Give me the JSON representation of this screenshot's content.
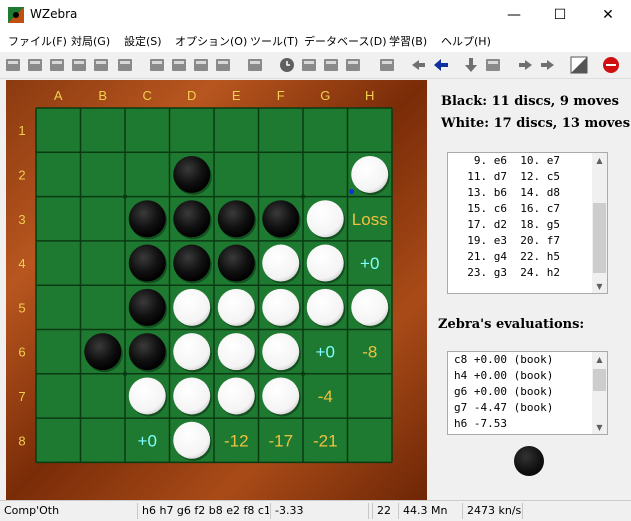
{
  "window": {
    "title": "WZebra"
  },
  "menu": [
    "ファイル(F)",
    "対局(G)",
    "設定(S)",
    "オプション(O)",
    "ツール(T)",
    "データベース(D)",
    "学習(B)",
    "ヘルプ(H)"
  ],
  "toolbar": {
    "icons": [
      "new-game-icon",
      "new-board-icon",
      "open-icon",
      "save-icon",
      "save-as-icon",
      "folder-icon",
      "swap-icon",
      "print-icon",
      "print-preview-icon",
      "zebra-z-icon",
      "wand-icon",
      "clock-icon",
      "stop-icon",
      "pause-icon",
      "step-icon",
      "book-icon",
      "undo-all-icon",
      "back-icon",
      "down-icon",
      "hint-icon",
      "forward-icon",
      "redo-all-icon",
      "flip-board-icon",
      "stop-search-icon"
    ]
  },
  "board": {
    "columns": [
      "A",
      "B",
      "C",
      "D",
      "E",
      "F",
      "G",
      "H"
    ],
    "rows": [
      "1",
      "2",
      "3",
      "4",
      "5",
      "6",
      "7",
      "8"
    ],
    "discs": [
      {
        "sq": "D2",
        "color": "black"
      },
      {
        "sq": "H2",
        "color": "white"
      },
      {
        "sq": "C3",
        "color": "black"
      },
      {
        "sq": "D3",
        "color": "black"
      },
      {
        "sq": "E3",
        "color": "black"
      },
      {
        "sq": "F3",
        "color": "black"
      },
      {
        "sq": "G3",
        "color": "white"
      },
      {
        "sq": "C4",
        "color": "black"
      },
      {
        "sq": "D4",
        "color": "black"
      },
      {
        "sq": "E4",
        "color": "black"
      },
      {
        "sq": "F4",
        "color": "white"
      },
      {
        "sq": "G4",
        "color": "white"
      },
      {
        "sq": "C5",
        "color": "black"
      },
      {
        "sq": "D5",
        "color": "white"
      },
      {
        "sq": "E5",
        "color": "white"
      },
      {
        "sq": "F5",
        "color": "white"
      },
      {
        "sq": "G5",
        "color": "white"
      },
      {
        "sq": "H5",
        "color": "white"
      },
      {
        "sq": "B6",
        "color": "black"
      },
      {
        "sq": "C6",
        "color": "black"
      },
      {
        "sq": "D6",
        "color": "white"
      },
      {
        "sq": "E6",
        "color": "white"
      },
      {
        "sq": "F6",
        "color": "white"
      },
      {
        "sq": "C7",
        "color": "white"
      },
      {
        "sq": "D7",
        "color": "white"
      },
      {
        "sq": "E7",
        "color": "white"
      },
      {
        "sq": "F7",
        "color": "white"
      },
      {
        "sq": "D8",
        "color": "white"
      }
    ],
    "evals": [
      {
        "sq": "H3",
        "text": "Loss",
        "color": "#f0c040"
      },
      {
        "sq": "H4",
        "text": "+0",
        "color": "#80ffff"
      },
      {
        "sq": "G6",
        "text": "+0",
        "color": "#80ffff"
      },
      {
        "sq": "H6",
        "text": "-8",
        "color": "#f0c040"
      },
      {
        "sq": "G7",
        "text": "-4",
        "color": "#f0c040"
      },
      {
        "sq": "C8",
        "text": "+0",
        "color": "#80ffff"
      },
      {
        "sq": "E8",
        "text": "-12",
        "color": "#f0c040"
      },
      {
        "sq": "F8",
        "text": "-17",
        "color": "#f0c040"
      },
      {
        "sq": "G8",
        "text": "-21",
        "color": "#f0c040"
      }
    ],
    "last_move_marker": "H2",
    "colors": {
      "felt": "#1e7a30",
      "line": "#0a3a12",
      "label": "#f0d050"
    }
  },
  "panel": {
    "black_stat": "Black:  11 discs, 9 moves",
    "white_stat": "White:  17 discs, 13 moves",
    "moves": [
      "   9. e6  10. e7",
      "  11. d7  12. c5",
      "  13. b6  14. d8",
      "  15. c6  16. c7",
      "  17. d2  18. g5",
      "  19. e3  20. f7",
      "  21. g4  22. h5",
      "  23. g3  24. h2"
    ],
    "eval_label": "Zebra's evaluations:",
    "evaluations": [
      "c8 +0.00 (book)",
      "h4 +0.00 (book)",
      "g6 +0.00 (book)",
      "g7 -4.47 (book)",
      "h6 -7.53"
    ],
    "turn_color": "black"
  },
  "status": [
    "Comp'Oth",
    "h6 h7 g6 f2 b8 e2 f8 c1",
    "-3.33",
    "",
    "22",
    "44.3 Mn",
    "2473 kn/s"
  ]
}
